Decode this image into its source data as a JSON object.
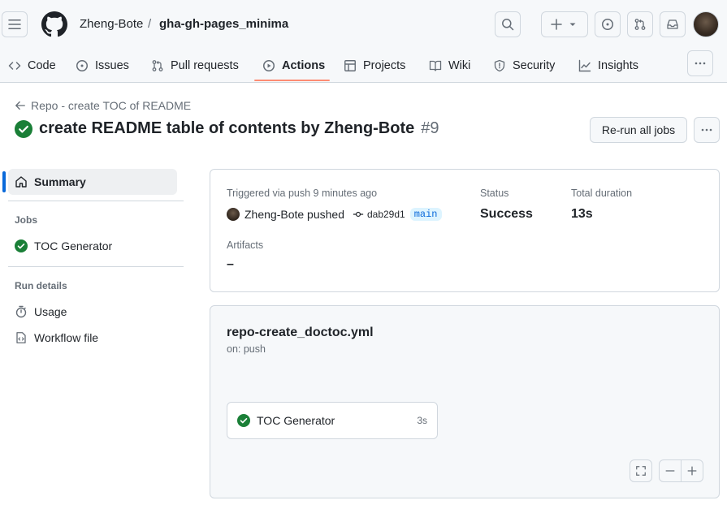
{
  "header": {
    "owner": "Zheng-Bote",
    "separator": "/",
    "repo": "gha-gh-pages_minima"
  },
  "nav": {
    "items": [
      {
        "label": "Code",
        "icon": "code-icon"
      },
      {
        "label": "Issues",
        "icon": "issue-icon"
      },
      {
        "label": "Pull requests",
        "icon": "pull-request-icon"
      },
      {
        "label": "Actions",
        "icon": "play-icon",
        "active": true
      },
      {
        "label": "Projects",
        "icon": "table-icon"
      },
      {
        "label": "Wiki",
        "icon": "book-icon"
      },
      {
        "label": "Security",
        "icon": "shield-icon"
      },
      {
        "label": "Insights",
        "icon": "graph-icon"
      }
    ]
  },
  "run": {
    "back_label": "Repo - create TOC of README",
    "title": "create README table of contents by Zheng-Bote",
    "number": "#9",
    "rerun_label": "Re-run all jobs"
  },
  "sidebar": {
    "summary_label": "Summary",
    "jobs_heading": "Jobs",
    "job_label": "TOC Generator",
    "run_details_heading": "Run details",
    "usage_label": "Usage",
    "workflow_file_label": "Workflow file"
  },
  "summary": {
    "trigger_text": "Triggered via push 9 minutes ago",
    "actor_text": "Zheng-Bote pushed",
    "commit": "dab29d1",
    "branch": "main",
    "status_label": "Status",
    "status_value": "Success",
    "duration_label": "Total duration",
    "duration_value": "13s",
    "artifacts_label": "Artifacts",
    "artifacts_value": "–"
  },
  "graph": {
    "workflow_file": "repo-create_doctoc.yml",
    "trigger": "on: push",
    "job_name": "TOC Generator",
    "job_duration": "3s"
  },
  "colors": {
    "success": "#1a7f37",
    "accent": "#0969da",
    "nav_underline": "#fd8c73"
  }
}
